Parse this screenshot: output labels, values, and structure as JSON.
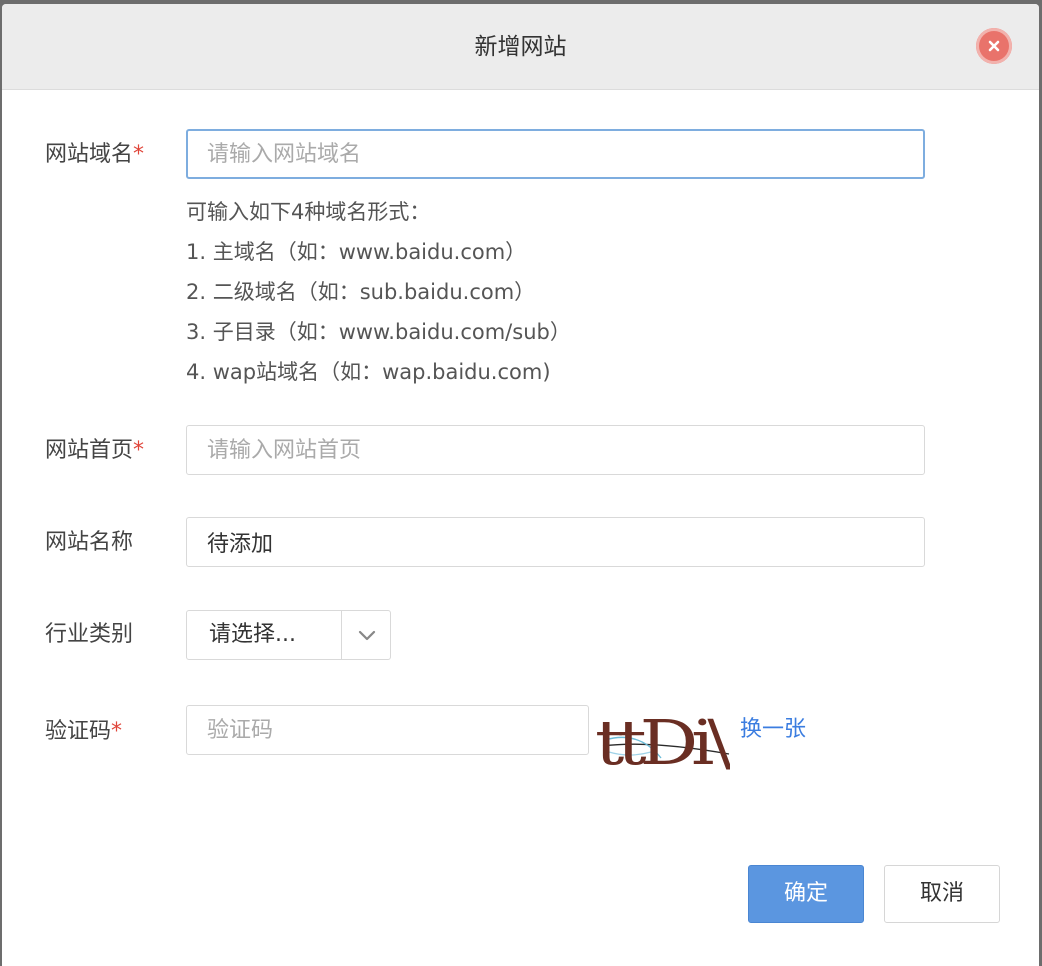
{
  "dialog": {
    "title": "新增网站"
  },
  "form": {
    "domain": {
      "label": "网站域名",
      "required_mark": "*",
      "placeholder": "请输入网站域名",
      "value": ""
    },
    "hints": [
      "可输入如下4种域名形式：",
      "1. 主域名（如：www.baidu.com）",
      "2. 二级域名（如：sub.baidu.com）",
      "3. 子目录（如：www.baidu.com/sub）",
      "4. wap站域名（如：wap.baidu.com)"
    ],
    "homepage": {
      "label": "网站首页",
      "required_mark": "*",
      "placeholder": "请输入网站首页",
      "value": ""
    },
    "site_name": {
      "label": "网站名称",
      "value": "待添加"
    },
    "industry": {
      "label": "行业类别",
      "selected": "请选择..."
    },
    "captcha": {
      "label": "验证码",
      "required_mark": "*",
      "placeholder": "验证码",
      "value": "",
      "image_text": "ttDi\\",
      "refresh_label": "换一张"
    }
  },
  "buttons": {
    "confirm": "确定",
    "cancel": "取消"
  },
  "colors": {
    "primary": "#5b96e0",
    "link": "#3b7de0",
    "required": "#e0453a",
    "close": "#e9736b",
    "focus_border": "#7eaddf"
  }
}
